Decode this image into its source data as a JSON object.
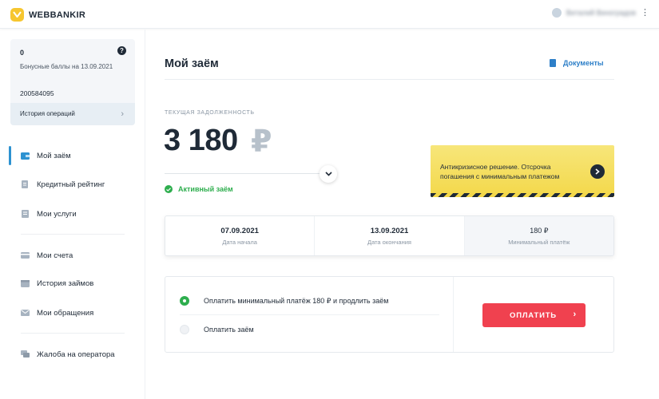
{
  "app": {
    "name": "WEBBANKIR"
  },
  "header": {
    "user_name": "Виталий Виноградов",
    "menu_glyph": "⋮"
  },
  "bonus": {
    "value": "0",
    "label": "Бонусные баллы на 13.09.2021",
    "help_glyph": "?",
    "account_number": "200584095",
    "history_label": "История операций",
    "history_chevron": "›"
  },
  "sidebar": {
    "items": [
      {
        "label": "Мой заём",
        "icon": "wallet-icon",
        "active": true
      },
      {
        "label": "Кредитный рейтинг",
        "icon": "document-icon"
      },
      {
        "label": "Мои услуги",
        "icon": "list-icon"
      },
      {
        "label": "Мои счета",
        "icon": "accounts-icon"
      },
      {
        "label": "История займов",
        "icon": "calendar-icon"
      },
      {
        "label": "Мои обращения",
        "icon": "mail-icon"
      },
      {
        "label": "Жалоба на оператора",
        "icon": "chat-icon"
      }
    ]
  },
  "main": {
    "title": "Мой заём",
    "docs_label": "Документы",
    "debt_label": "ТЕКУЩАЯ ЗАДОЛЖЕННОСТЬ",
    "debt_amount": "3 180",
    "debt_currency": "₽",
    "status": "Активный заём"
  },
  "promo": {
    "text": "Антикризисное решение. Отсрочка погашения с минимальным платежом",
    "arrow_glyph": "›"
  },
  "dates": [
    {
      "value": "07.09.2021",
      "label": "Дата начала"
    },
    {
      "value": "13.09.2021",
      "label": "Дата окончания"
    },
    {
      "value": "180 ₽",
      "label": "Минимальный платёж"
    }
  ],
  "payment": {
    "options": [
      {
        "label": "Оплатить минимальный платёж 180 ₽ и продлить заём",
        "selected": true
      },
      {
        "label": "Оплатить заём",
        "selected": false
      }
    ],
    "button_label": "ОПЛАТИТЬ",
    "button_chevron": "›"
  },
  "colors": {
    "accent_blue": "#2d92d1",
    "green": "#2eae4e",
    "pay_red": "#f0414f",
    "promo_yellow": "#f3d84a"
  }
}
